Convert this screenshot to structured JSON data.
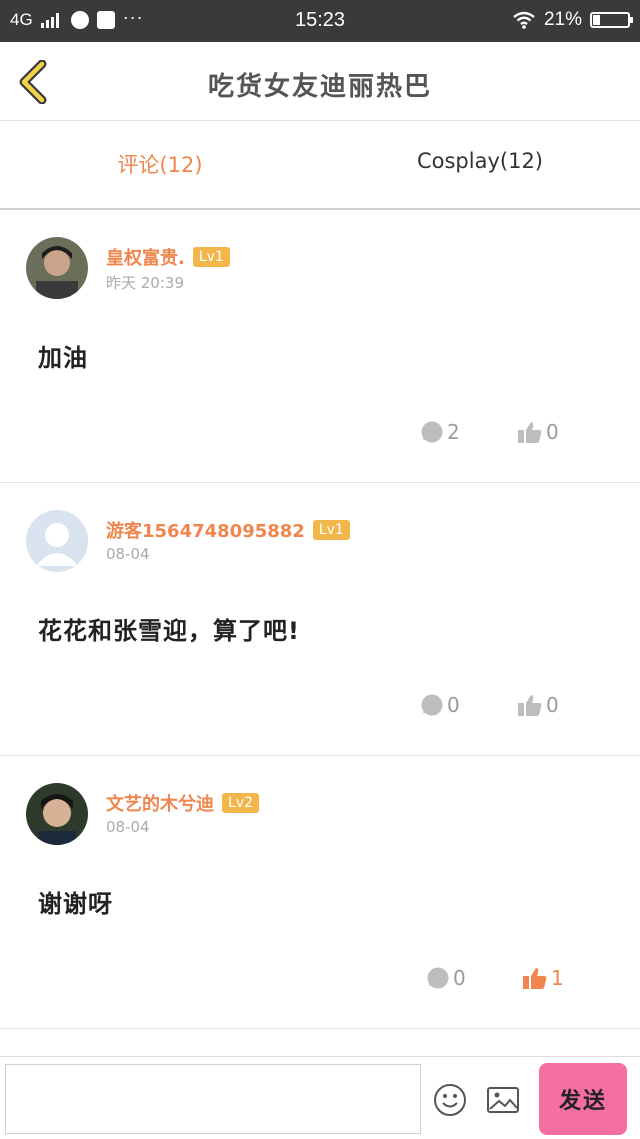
{
  "status_bar": {
    "network": "4G",
    "time": "15:23",
    "battery": "21%",
    "battery_level": 0.21
  },
  "header": {
    "title": "吃货女友迪丽热巴"
  },
  "tabs": [
    {
      "label": "评论(12)",
      "active": true
    },
    {
      "label": "Cosplay(12)",
      "active": false
    }
  ],
  "comments": [
    {
      "username": "皇权富贵.",
      "level": "Lv1",
      "time": "昨天 20:39",
      "content": "加油",
      "replies": "2",
      "likes": "0",
      "liked": false
    },
    {
      "username": "游客1564748095882",
      "level": "Lv1",
      "time": "08-04",
      "content": "花花和张雪迎，算了吧!",
      "replies": "0",
      "likes": "0",
      "liked": false
    },
    {
      "username": "文艺的木兮迪",
      "level": "Lv2",
      "time": "08-04",
      "content": "谢谢呀",
      "replies": "0",
      "likes": "1",
      "liked": true
    }
  ],
  "bottom_bar": {
    "input_value": "",
    "send_label": "发送"
  },
  "colors": {
    "accent": "#f0864f",
    "level_badge": "#f3b64a",
    "send_button": "#f56fa3",
    "status_bar": "#3a3a3a"
  }
}
